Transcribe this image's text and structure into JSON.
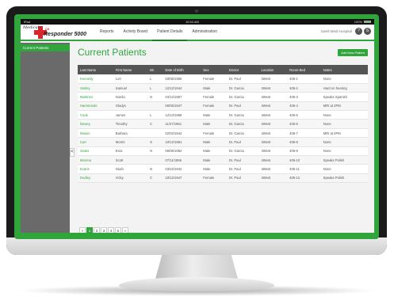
{
  "status_bar": {
    "device": "iPad",
    "time": "10:54 AM",
    "battery": "100%"
  },
  "logo": {
    "top_word": "Medical",
    "middle_word": "CII",
    "main_word": "Responder 5000"
  },
  "nav": {
    "tabs": [
      "Reports",
      "Activity Board",
      "Patient Details",
      "Administration"
    ],
    "active": "Patient Details"
  },
  "user": {
    "hospital": "Swell Medi Hospital",
    "help_label": "?",
    "user_label": "S"
  },
  "sidebar": {
    "items": [
      {
        "label": "Current Patients"
      }
    ],
    "collapse_label": "<"
  },
  "main": {
    "title": "Current Patients",
    "add_button": "Add New Patient"
  },
  "table": {
    "columns": [
      "Last Name",
      "First Name",
      "MI.",
      "Date of Birth",
      "Sex",
      "Doctor",
      "Location",
      "Room-Bed",
      "Notes"
    ],
    "rows": [
      [
        "Kennedy",
        "Lori",
        "L",
        "03/05/1950",
        "Female",
        "Dr. Paul",
        "4West",
        "405-1",
        "None"
      ],
      [
        "Smiley",
        "Samuel",
        "L",
        "12/12/1944",
        "Male",
        "Dr. Garcia",
        "4West",
        "405-2",
        "Hard on hearing"
      ],
      [
        "Martinez",
        "Noelia",
        "N",
        "04/12/1957",
        "Female",
        "Dr. Garcia",
        "4West",
        "405-3",
        "Speaks Spanish"
      ],
      [
        "Hammonds",
        "Gladys",
        "",
        "06/05/1947",
        "Female",
        "Dr. Paul",
        "4West",
        "405-4",
        "MRI at 2PM"
      ],
      [
        "Cook",
        "James",
        "L",
        "12/13/1958",
        "Male",
        "Dr. Garcia",
        "4West",
        "405-5",
        "None"
      ],
      [
        "Dewey",
        "Timothy",
        "C",
        "11/27/1951",
        "Male",
        "Dr. Garcia",
        "4West",
        "405-6",
        "None"
      ],
      [
        "Mason",
        "Barbara",
        "",
        "02/02/1944",
        "Female",
        "Dr. Garcia",
        "4West",
        "405-7",
        "MRI at 4PM"
      ],
      [
        "Carr",
        "Morris",
        "S",
        "10/12/1961",
        "Male",
        "Dr. Paul",
        "4West",
        "405-8",
        "None"
      ],
      [
        "Gates",
        "Esra",
        "N",
        "06/06/1952",
        "Male",
        "Dr. Garcia",
        "4West",
        "405-9",
        "None"
      ],
      [
        "Moreno",
        "Scott",
        "",
        "07/11/1955",
        "Male",
        "Dr. Paul",
        "4West",
        "405-10",
        "Speaks Polish"
      ],
      [
        "Evans",
        "Noah",
        "N",
        "03/22/1942",
        "Male",
        "Dr. Paul",
        "4West",
        "405-11",
        "None"
      ],
      [
        "Dudley",
        "Vicky",
        "C",
        "10/12/1947",
        "Female",
        "Dr. Paul",
        "4West",
        "405-12",
        "Speaks Polish"
      ]
    ]
  },
  "pagination": {
    "items": [
      "«",
      "1",
      "2",
      "3",
      "4",
      "5",
      "»"
    ],
    "active": "1"
  },
  "colors": {
    "brand_green": "#2fa53c",
    "brand_red": "#d7262e",
    "header_gray": "#555555"
  }
}
